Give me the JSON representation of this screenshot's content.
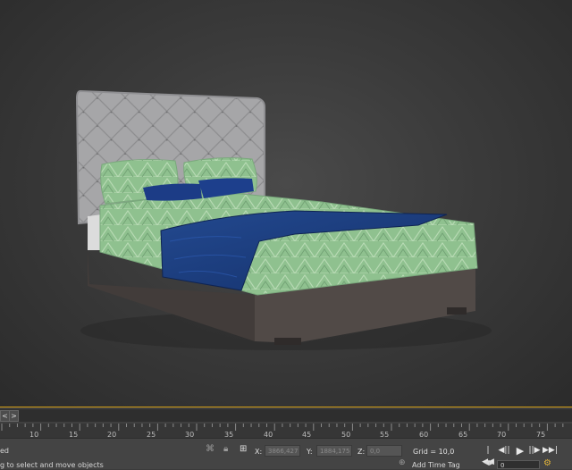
{
  "timeline": {
    "prev_label": "<",
    "next_label": ">",
    "ticks": [
      "10",
      "15",
      "20",
      "25",
      "30",
      "35",
      "40",
      "45",
      "50",
      "55",
      "60",
      "65",
      "70",
      "75"
    ]
  },
  "status": {
    "line1": "ed",
    "line2": "g to select and move objects"
  },
  "coords": {
    "x_label": "X:",
    "x_value": "3866,427",
    "y_label": "Y:",
    "y_value": "1884,175",
    "z_label": "Z:",
    "z_value": "0,0",
    "grid_text": "Grid = 10,0",
    "add_time_tag": "Add Time Tag"
  },
  "playback": {
    "goto_start": "|◀◀",
    "prev_frame": "◀||",
    "play": "▶",
    "next_frame": "||▶",
    "goto_end": "▶▶|",
    "frame_value": "0"
  },
  "colors": {
    "accent": "#d4a017",
    "headboard": "#a9a9aa",
    "sheet": "#8dbf8f",
    "throw": "#1b3d80",
    "base": "#4b4543"
  }
}
